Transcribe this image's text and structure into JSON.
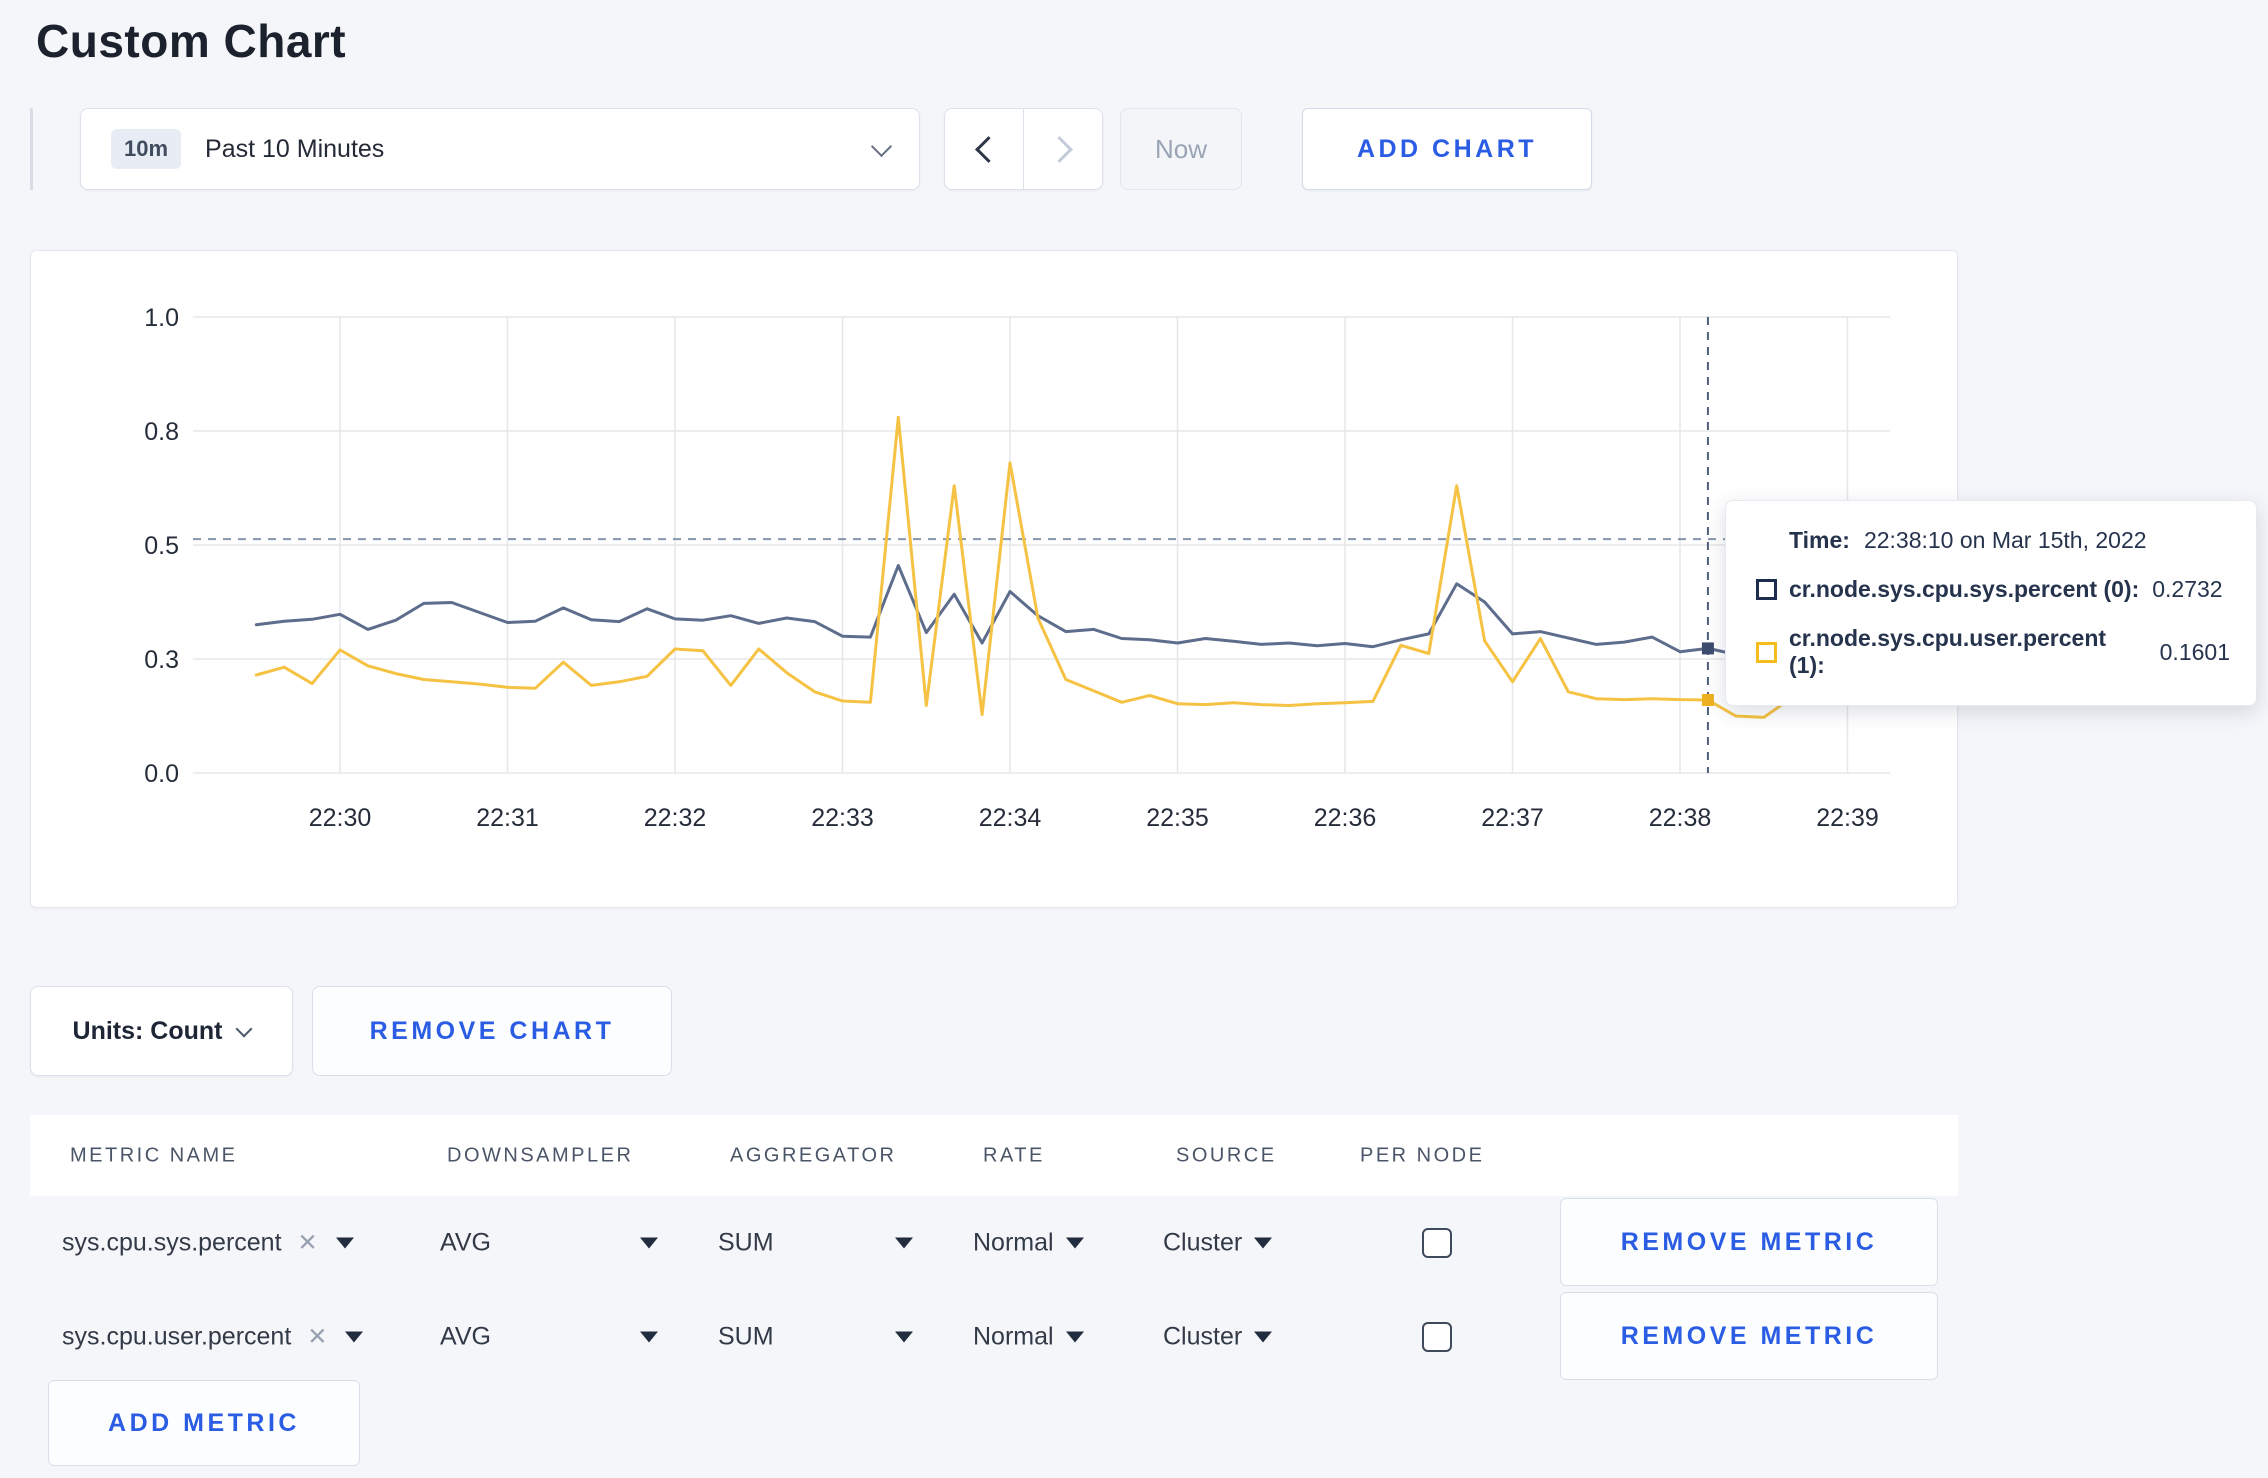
{
  "page": {
    "title": "Custom Chart"
  },
  "colors": {
    "accent_blue": "#2b5de4",
    "page_bg": "#f5f6fa",
    "series_sys": "#5e6d8c",
    "series_user": "#f5c243"
  },
  "toolbar": {
    "time_badge": "10m",
    "time_label": "Past 10 Minutes",
    "now_label": "Now",
    "add_chart_label": "ADD CHART"
  },
  "icons": {
    "close": "✕"
  },
  "chart_data": {
    "type": "line",
    "title": "",
    "xlabel": "",
    "ylabel": "",
    "x_axis": {
      "tick_labels": [
        "22:30",
        "22:31",
        "22:32",
        "22:33",
        "22:34",
        "22:35",
        "22:36",
        "22:37",
        "22:38",
        "22:39"
      ],
      "start": "22:29:30",
      "interval_seconds": 10,
      "points": 59
    },
    "y_axis": {
      "range": [
        0,
        1
      ],
      "tick_values": [
        0,
        0.25,
        0.5,
        0.75,
        1.0
      ],
      "tick_labels": [
        "0.0",
        "0.3",
        "0.5",
        "0.8",
        "1.0"
      ]
    },
    "grid": true,
    "legend_position": "tooltip",
    "series": [
      {
        "name": "cr.node.sys.cpu.sys.percent (0)",
        "color": "#5e6d8c",
        "point_color": "#3d4c6e",
        "values": [
          0.325,
          0.333,
          0.337,
          0.348,
          0.315,
          0.335,
          0.372,
          0.374,
          0.352,
          0.33,
          0.333,
          0.362,
          0.336,
          0.332,
          0.36,
          0.338,
          0.335,
          0.345,
          0.328,
          0.34,
          0.332,
          0.3,
          0.298,
          0.455,
          0.308,
          0.392,
          0.285,
          0.398,
          0.345,
          0.31,
          0.315,
          0.295,
          0.292,
          0.285,
          0.295,
          0.289,
          0.282,
          0.285,
          0.279,
          0.284,
          0.277,
          0.292,
          0.305,
          0.415,
          0.375,
          0.305,
          0.31,
          0.296,
          0.282,
          0.287,
          0.298,
          0.266,
          0.2732,
          0.26,
          0.268,
          0.27,
          0.268,
          0.276,
          0.27
        ]
      },
      {
        "name": "cr.node.sys.cpu.user.percent (1)",
        "color": "#f5c243",
        "point_color": "#edb01e",
        "values": [
          0.215,
          0.232,
          0.196,
          0.27,
          0.235,
          0.218,
          0.205,
          0.2,
          0.195,
          0.188,
          0.186,
          0.243,
          0.192,
          0.2,
          0.212,
          0.272,
          0.268,
          0.192,
          0.272,
          0.22,
          0.178,
          0.158,
          0.155,
          0.78,
          0.148,
          0.63,
          0.128,
          0.68,
          0.34,
          0.205,
          0.18,
          0.155,
          0.17,
          0.152,
          0.15,
          0.154,
          0.15,
          0.148,
          0.152,
          0.154,
          0.157,
          0.28,
          0.262,
          0.63,
          0.29,
          0.2,
          0.295,
          0.178,
          0.163,
          0.161,
          0.163,
          0.161,
          0.1601,
          0.125,
          0.122,
          0.165,
          0.29,
          0.16,
          0.258
        ]
      }
    ],
    "crosshair": {
      "index": 52,
      "time": "22:38:10",
      "mouse_value": 0.513
    },
    "tooltip": {
      "time_label": "Time:",
      "time_value": "22:38:10 on Mar 15th, 2022",
      "rows": [
        {
          "name": "cr.node.sys.cpu.sys.percent (0):",
          "value": "0.2732",
          "color": "#1e2c4e"
        },
        {
          "name": "cr.node.sys.cpu.user.percent (1):",
          "value": "0.1601",
          "color": "#f5bd1c"
        }
      ]
    }
  },
  "chart_footer": {
    "units_label": "Units: Count",
    "remove_chart_label": "REMOVE CHART"
  },
  "metrics_table": {
    "headers": [
      "METRIC NAME",
      "DOWNSAMPLER",
      "AGGREGATOR",
      "RATE",
      "SOURCE",
      "PER NODE"
    ],
    "rows": [
      {
        "metric": "sys.cpu.sys.percent",
        "downsampler": "AVG",
        "aggregator": "SUM",
        "rate": "Normal",
        "source": "Cluster",
        "per_node": false,
        "remove_label": "REMOVE METRIC"
      },
      {
        "metric": "sys.cpu.user.percent",
        "downsampler": "AVG",
        "aggregator": "SUM",
        "rate": "Normal",
        "source": "Cluster",
        "per_node": false,
        "remove_label": "REMOVE METRIC"
      }
    ],
    "add_metric_label": "ADD METRIC"
  }
}
